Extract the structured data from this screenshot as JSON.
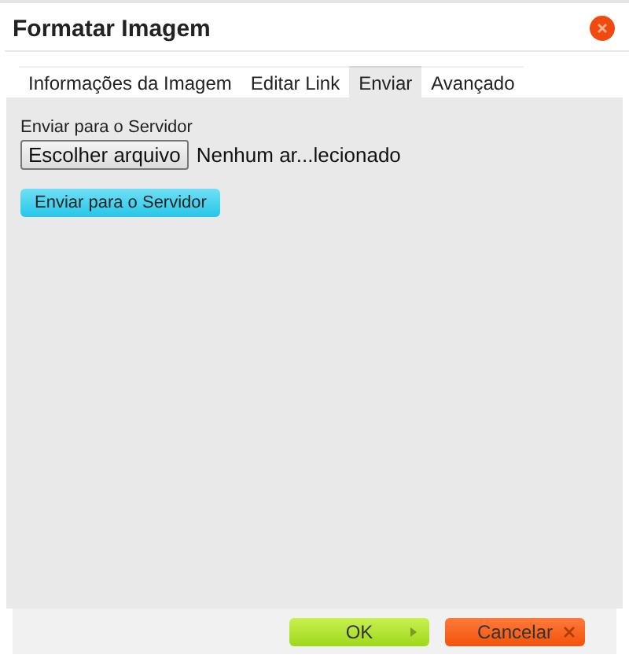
{
  "window": {
    "title": "Formatar Imagem"
  },
  "tabs": [
    {
      "label": "Informações da Imagem",
      "selected": false
    },
    {
      "label": "Editar Link",
      "selected": false
    },
    {
      "label": "Enviar",
      "selected": true
    },
    {
      "label": "Avançado",
      "selected": false
    }
  ],
  "upload": {
    "label": "Enviar para o Servidor",
    "file_button": "Escolher arquivo",
    "file_status": "Nenhum ar...lecionado",
    "submit": "Enviar para o Servidor"
  },
  "buttons": [
    {
      "kind": "ok",
      "label": "OK"
    },
    {
      "kind": "cancel",
      "label": "Cancelar"
    }
  ]
}
